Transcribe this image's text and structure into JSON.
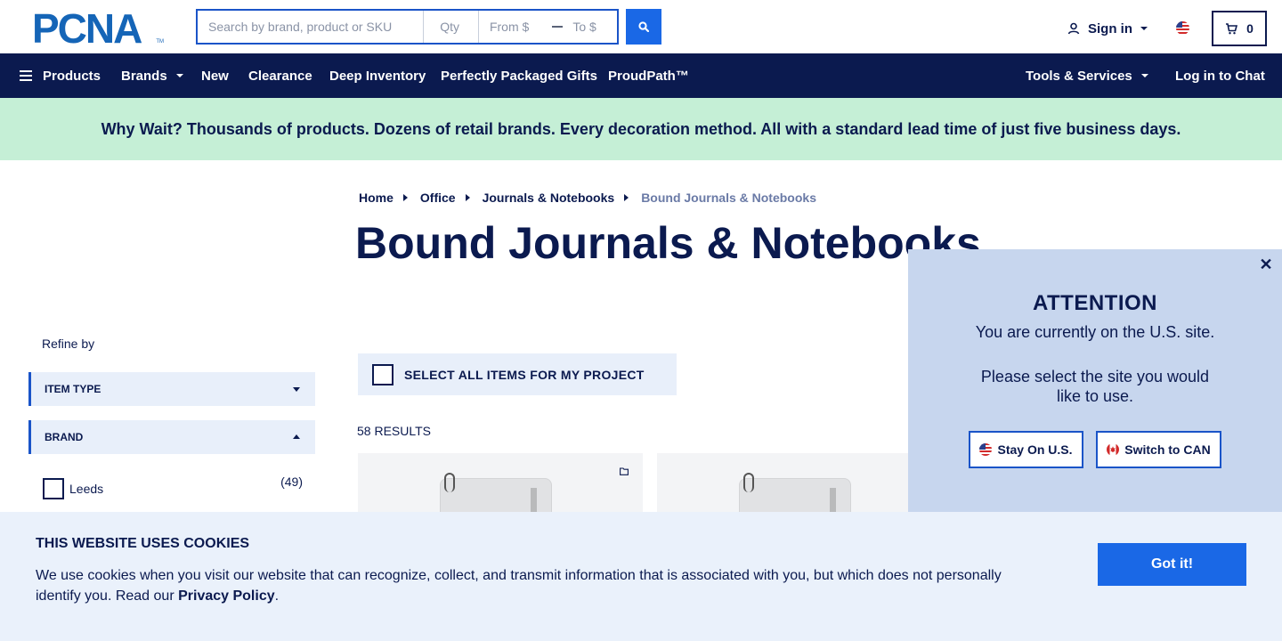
{
  "header": {
    "logo_text": "PCNA",
    "logo_tm": "TM",
    "search_placeholder": "Search by brand, product or SKU",
    "qty_placeholder": "Qty",
    "from_placeholder": "From $",
    "to_placeholder": "To $",
    "sign_in_label": "Sign in",
    "cart_count": "0"
  },
  "nav": {
    "products": "Products",
    "brands": "Brands",
    "new": "New",
    "clearance": "Clearance",
    "deep_inventory": "Deep Inventory",
    "gifts": "Perfectly Packaged Gifts",
    "proudpath": "ProudPath™",
    "tools": "Tools & Services",
    "chat": "Log in to Chat"
  },
  "promo": "Why Wait? Thousands of products. Dozens of retail brands. Every decoration method. All with a standard lead time of just five business days.",
  "breadcrumb": [
    "Home",
    "Office",
    "Journals & Notebooks",
    "Bound Journals & Notebooks"
  ],
  "page_title": "Bound Journals & Notebooks",
  "sidebar": {
    "refine_label": "Refine by",
    "filters": [
      {
        "label": "ITEM TYPE",
        "expanded": false
      },
      {
        "label": "BRAND",
        "expanded": true
      }
    ],
    "brand_options": [
      {
        "label": "Leeds",
        "count": "(49)",
        "checked": false
      }
    ]
  },
  "results": {
    "select_all_label": "SELECT ALL ITEMS FOR MY PROJECT",
    "count_label": "58 RESULTS"
  },
  "attention": {
    "heading": "ATTENTION",
    "line1": "You are currently on the U.S. site.",
    "line2": "Please select the site you would like to use.",
    "stay_label": "Stay On U.S.",
    "switch_label": "Switch to CAN",
    "close_glyph": "✕"
  },
  "cookie": {
    "title": "THIS WEBSITE USES COOKIES",
    "body_text": "We use cookies when you visit our website that can recognize, collect, and transmit information that is associated with you, but which does not personally identify you. Read our ",
    "policy_link": "Privacy Policy",
    "body_end": ".",
    "button_label": "Got it!"
  },
  "colors": {
    "navy": "#0b1a4f",
    "accent_blue": "#1a68e6",
    "promo_green": "#c5efd6",
    "popup_blue": "#c7d6ee",
    "cookie_bg": "#eaf1fb"
  }
}
